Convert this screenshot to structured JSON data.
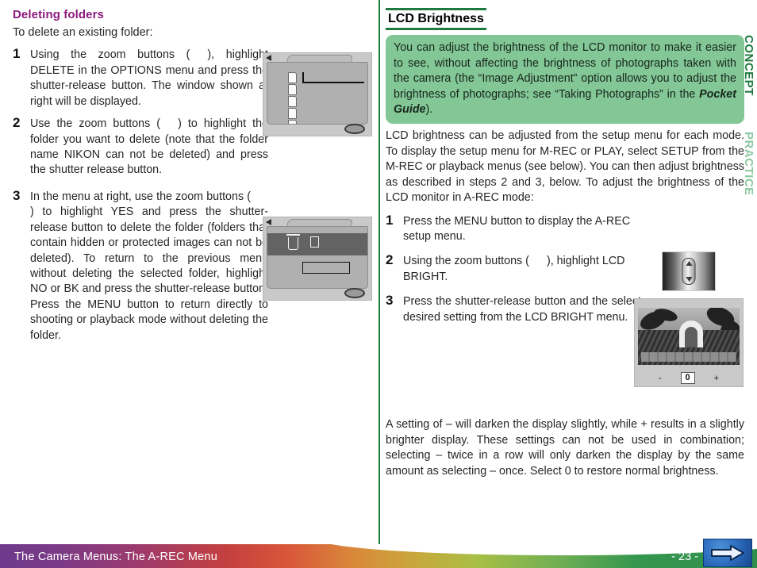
{
  "left_column": {
    "heading": "Deleting folders",
    "intro": "To delete an existing folder:",
    "steps": [
      {
        "number": "1",
        "text_before": "Using the zoom buttons (",
        "text_after": "), highlight DELETE in the OPTIONS menu and press the shutter-release button. The window shown at right will be displayed."
      },
      {
        "number": "2",
        "text_before": "Use the zoom buttons (",
        "text_after": ") to highlight the folder you want to delete (note that the folder name NIKON can not be deleted) and press the shutter release button."
      },
      {
        "number": "3",
        "text_before": "In the menu at right, use the zoom buttons (",
        "text_after": ") to highlight YES and press the shutter-release button to delete the folder (folders that contain hidden or protected images can not be deleted). To return to the previous menu without deleting the selected folder, highlight NO or BK and press the shutter-release button. Press the MENU button to return directly to shooting or playback mode without deleting the folder."
      }
    ]
  },
  "right_column": {
    "heading": "LCD Brightness",
    "callout": "You can adjust the brightness of the LCD monitor to make it easier to see, without affecting the brightness of photographs taken with the camera (the “Image Adjustment” option allows you to adjust the brightness of photographs; see “Taking Photographs” in the Pocket Guide).",
    "callout_italic_term": "Pocket Guide",
    "intro_paragraph": "LCD brightness can be adjusted from the setup menu for each mode.  To display the setup menu for M-REC or PLAY, select SETUP from the M-REC or playback menus (see below). You can then adjust brightness as described in steps 2 and 3, below.  To adjust the brightness of the LCD monitor in A-REC mode:",
    "steps": [
      {
        "number": "1",
        "text_before": "Press the MENU button to display the A-REC setup menu.",
        "text_after": ""
      },
      {
        "number": "2",
        "text_before": "Using the zoom buttons (",
        "text_after": "), highlight LCD BRIGHT."
      },
      {
        "number": "3",
        "text_before": "Press the shutter-release button and the select desired setting from the LCD BRIGHT menu.",
        "text_after": ""
      }
    ],
    "closing_paragraph": "A setting of – will darken the display slightly, while + results in a slightly brighter display.  These settings can not be used in combination; selecting – twice in a row will only darken the display by the same amount as selecting – once. Select 0 to restore normal brightness.",
    "side_labels": {
      "concept": "CONCEPT",
      "practice": "PRACTICE"
    },
    "lcd_bright_controls": {
      "minus": "-",
      "current": "0",
      "plus": "+"
    }
  },
  "footer": {
    "title": "The Camera Menus: The A-REC Menu",
    "page_number": "- 23 -",
    "next_icon": "right-arrow-icon"
  },
  "colors": {
    "heading_purple": "#8b1a7d",
    "rule_green": "#1f7a3f",
    "callout_green": "#83c796",
    "practice_label_green": "#8dc9a0"
  }
}
